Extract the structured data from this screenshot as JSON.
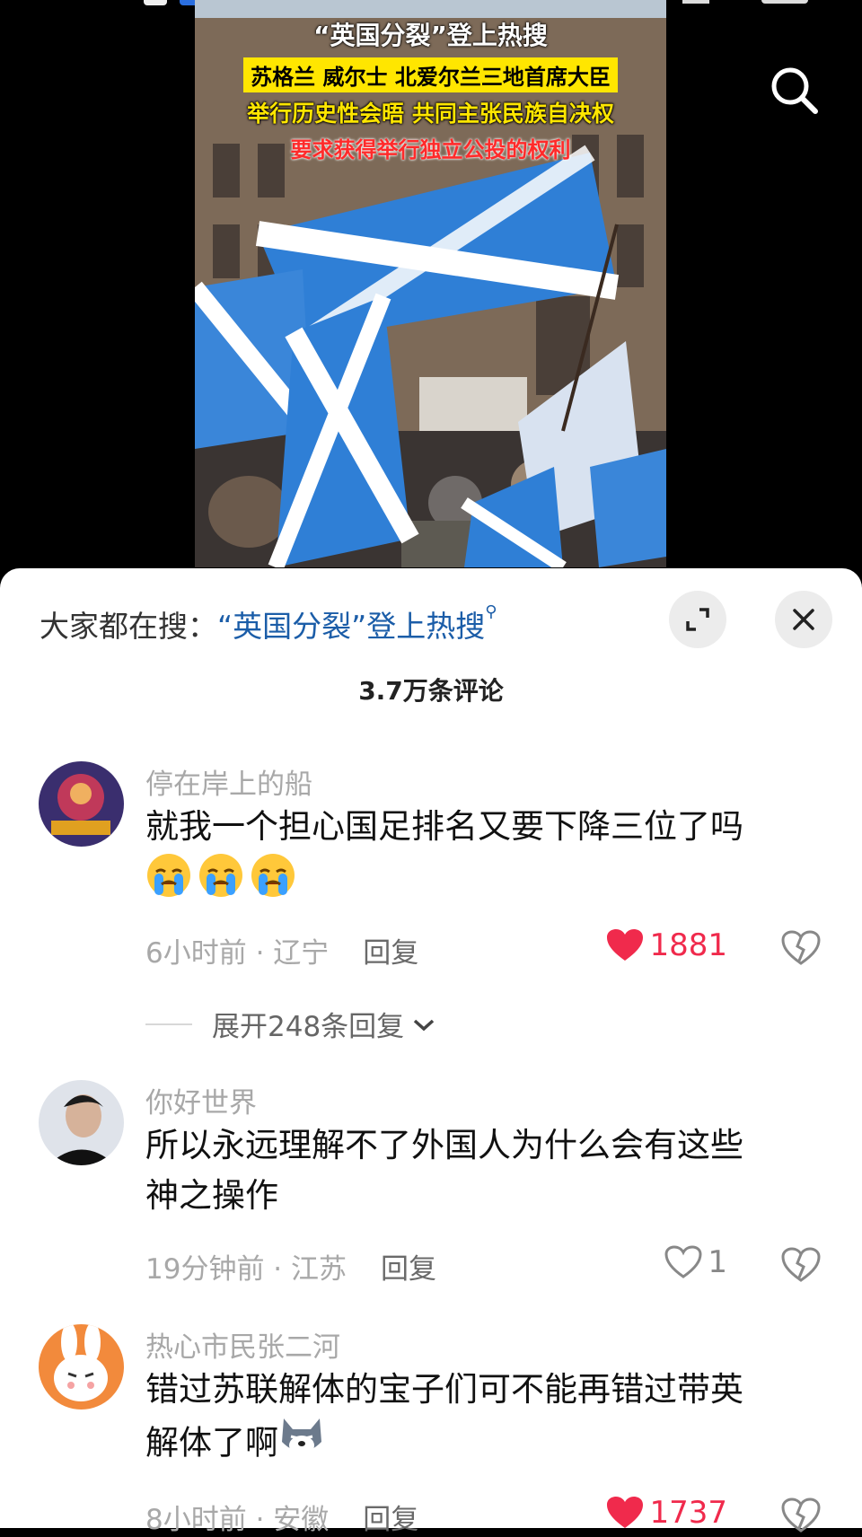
{
  "video": {
    "headline_title": "“英国分裂”登上热搜",
    "headline_line2": "苏格兰 威尔士 北爱尔兰三地首席大臣",
    "headline_line3": "举行历史性会晤 共同主张民族自决权",
    "headline_line4": "要求获得举行独立公投的权利"
  },
  "sheet": {
    "hot_search_prefix": "大家都在搜：",
    "hot_search_term": "“英国分裂”登上热搜",
    "comment_count": "3.7万条评论"
  },
  "comments": [
    {
      "user": "停在岸上的船",
      "text": "就我一个担心国足排名又要下降三位了吗",
      "emojis": [
        "crying-face-icon",
        "crying-face-icon",
        "crying-face-icon"
      ],
      "time": "6小时前",
      "location": "辽宁",
      "reply_label": "回复",
      "likes": "1881",
      "liked": true,
      "expand_label": "展开248条回复"
    },
    {
      "user": "你好世界",
      "text_line1": "所以永远理解不了外国人为什么会有这些",
      "text_line2": "神之操作",
      "time": "19分钟前",
      "location": "江苏",
      "reply_label": "回复",
      "likes": "1",
      "liked": false
    },
    {
      "user": "热心市民张二河",
      "text_line1": "错过苏联解体的宝子们可不能再错过带英",
      "text_line2": "解体了啊",
      "time": "8小时前",
      "location": "安徽",
      "reply_label": "回复",
      "likes": "1737",
      "liked": true
    }
  ],
  "meta_separator": " · ",
  "colors": {
    "like_red": "#f02a4c",
    "link_blue": "#1b5da8"
  }
}
